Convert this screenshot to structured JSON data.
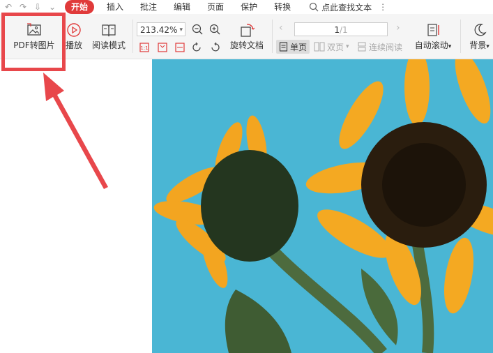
{
  "menubar": {
    "quick_access": [
      {
        "name": "undo-icon",
        "glyph": "↶"
      },
      {
        "name": "redo-icon",
        "glyph": "↷"
      },
      {
        "name": "export-pdf-icon",
        "glyph": "⇩"
      },
      {
        "name": "chevron-down-icon",
        "glyph": "⌄"
      }
    ],
    "tabs": [
      "开始",
      "插入",
      "批注",
      "编辑",
      "页面",
      "保护",
      "转换"
    ],
    "active_tab": "开始",
    "search_label": "点此查找文本"
  },
  "ribbon": {
    "pdf_to_image": "PDF转图片",
    "play": "播放",
    "read_mode": "阅读模式",
    "zoom_value": "213.42%",
    "rotate_doc": "旋转文档",
    "page_current": "1",
    "page_total": "/1",
    "single_page": "单页",
    "double_page": "双页",
    "continuous_read": "连续阅读",
    "auto_scroll": "自动滚动",
    "background": "背景"
  },
  "colors": {
    "accent": "#e03a3a",
    "annotation": "#e8474b",
    "photo_bg": "#4ab6d4",
    "petal": "#f3a520",
    "center": "#2a1d0e"
  }
}
